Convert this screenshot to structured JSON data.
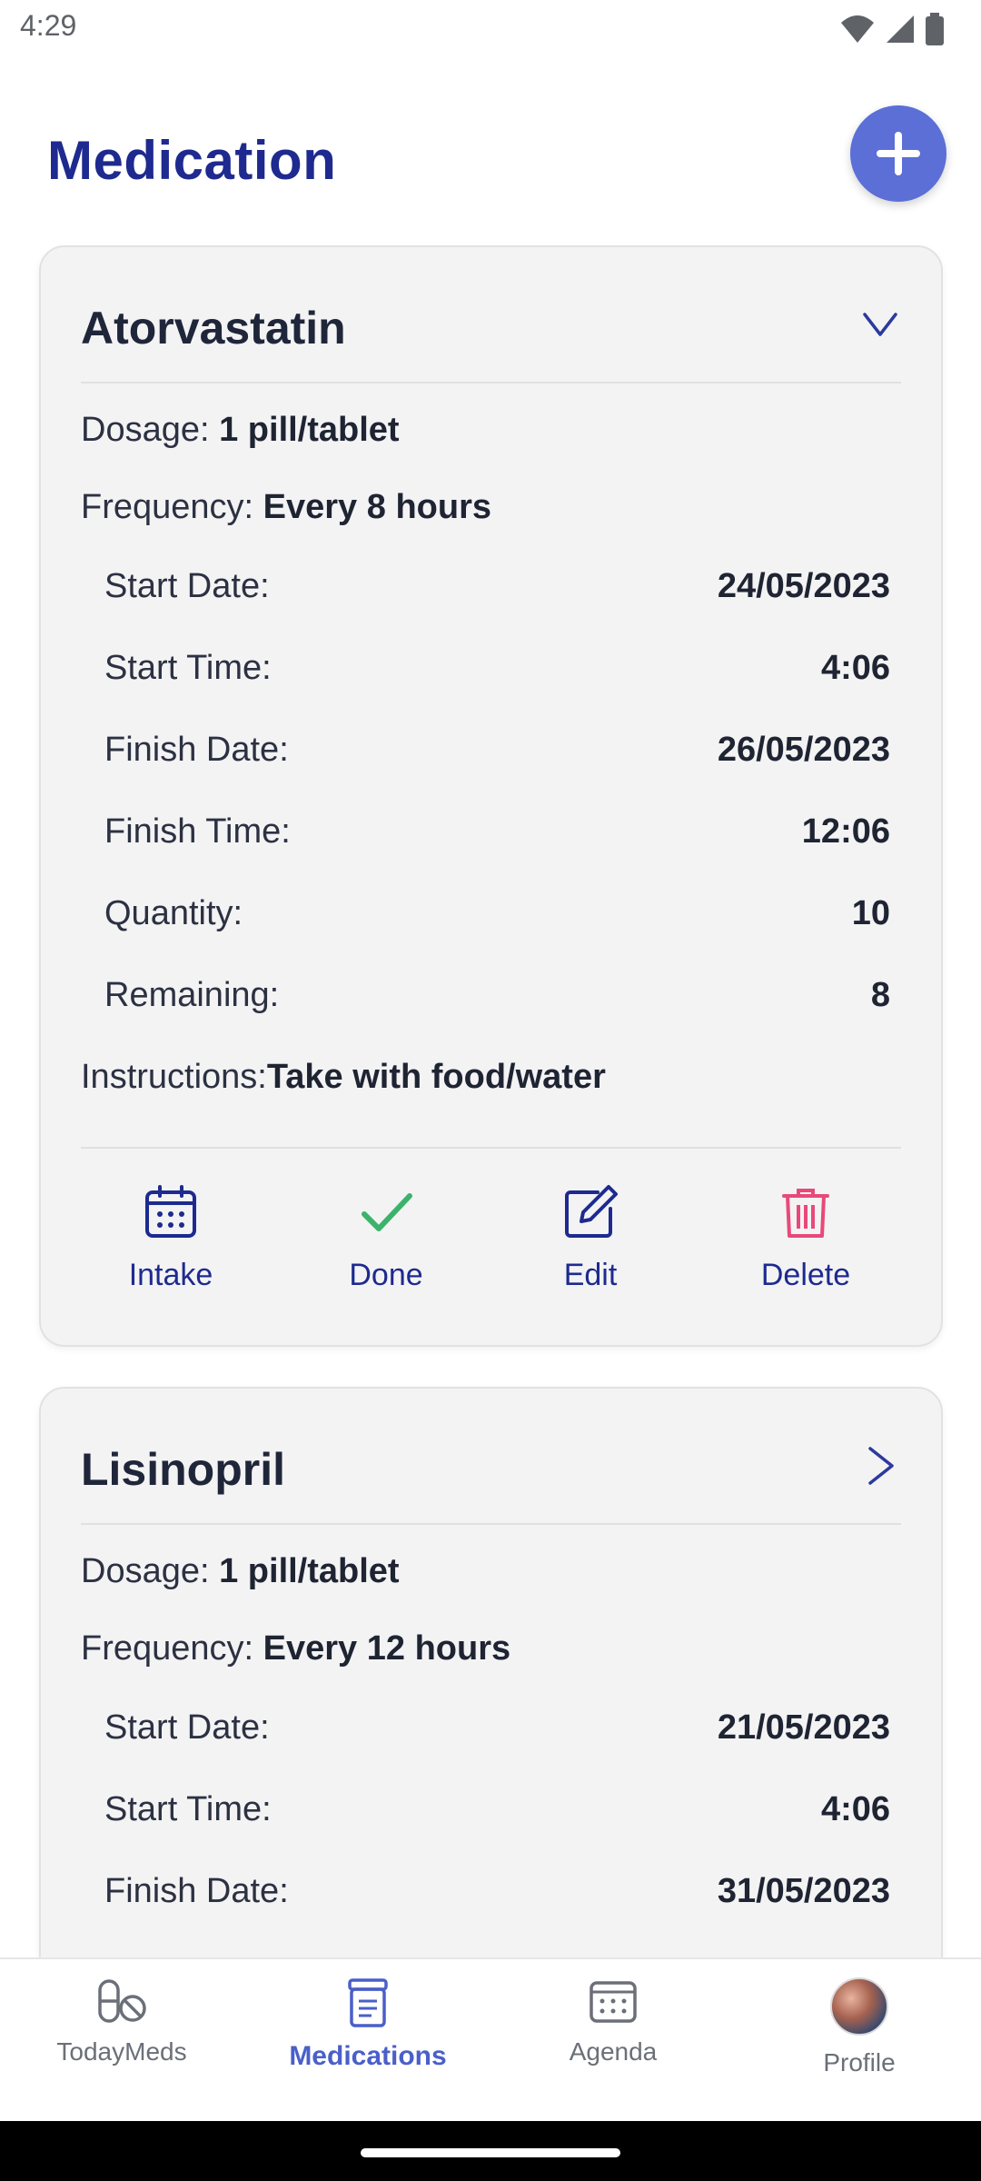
{
  "status_bar": {
    "time": "4:29"
  },
  "header": {
    "title": "Medication"
  },
  "medications": [
    {
      "name": "Atorvastatin",
      "dosage_label": "Dosage:",
      "dosage": "1 pill/tablet",
      "frequency_label": "Frequency:",
      "frequency": "Every 8 hours",
      "start_date_label": "Start Date:",
      "start_date": "24/05/2023",
      "start_time_label": "Start Time:",
      "start_time": "4:06",
      "finish_date_label": "Finish Date:",
      "finish_date": "26/05/2023",
      "finish_time_label": "Finish Time:",
      "finish_time": "12:06",
      "quantity_label": "Quantity:",
      "quantity": "10",
      "remaining_label": "Remaining:",
      "remaining": "8",
      "instructions_label": "Instructions:",
      "instructions": "Take with food/water",
      "expanded": true
    },
    {
      "name": "Lisinopril",
      "dosage_label": "Dosage:",
      "dosage": "1 pill/tablet",
      "frequency_label": "Frequency:",
      "frequency": "Every 12 hours",
      "start_date_label": "Start Date:",
      "start_date": "21/05/2023",
      "start_time_label": "Start Time:",
      "start_time": "4:06",
      "finish_date_label": "Finish Date:",
      "finish_date": "31/05/2023",
      "expanded": false
    }
  ],
  "actions": {
    "intake": "Intake",
    "done": "Done",
    "edit": "Edit",
    "delete": "Delete"
  },
  "nav": {
    "today": "TodayMeds",
    "medications": "Medications",
    "agenda": "Agenda",
    "profile": "Profile",
    "active": "Medications"
  },
  "colors": {
    "title": "#1e2a8f",
    "fab": "#5b6fd6",
    "done": "#3bb36b",
    "delete": "#e8497a",
    "active_nav": "#4a5fc9"
  }
}
